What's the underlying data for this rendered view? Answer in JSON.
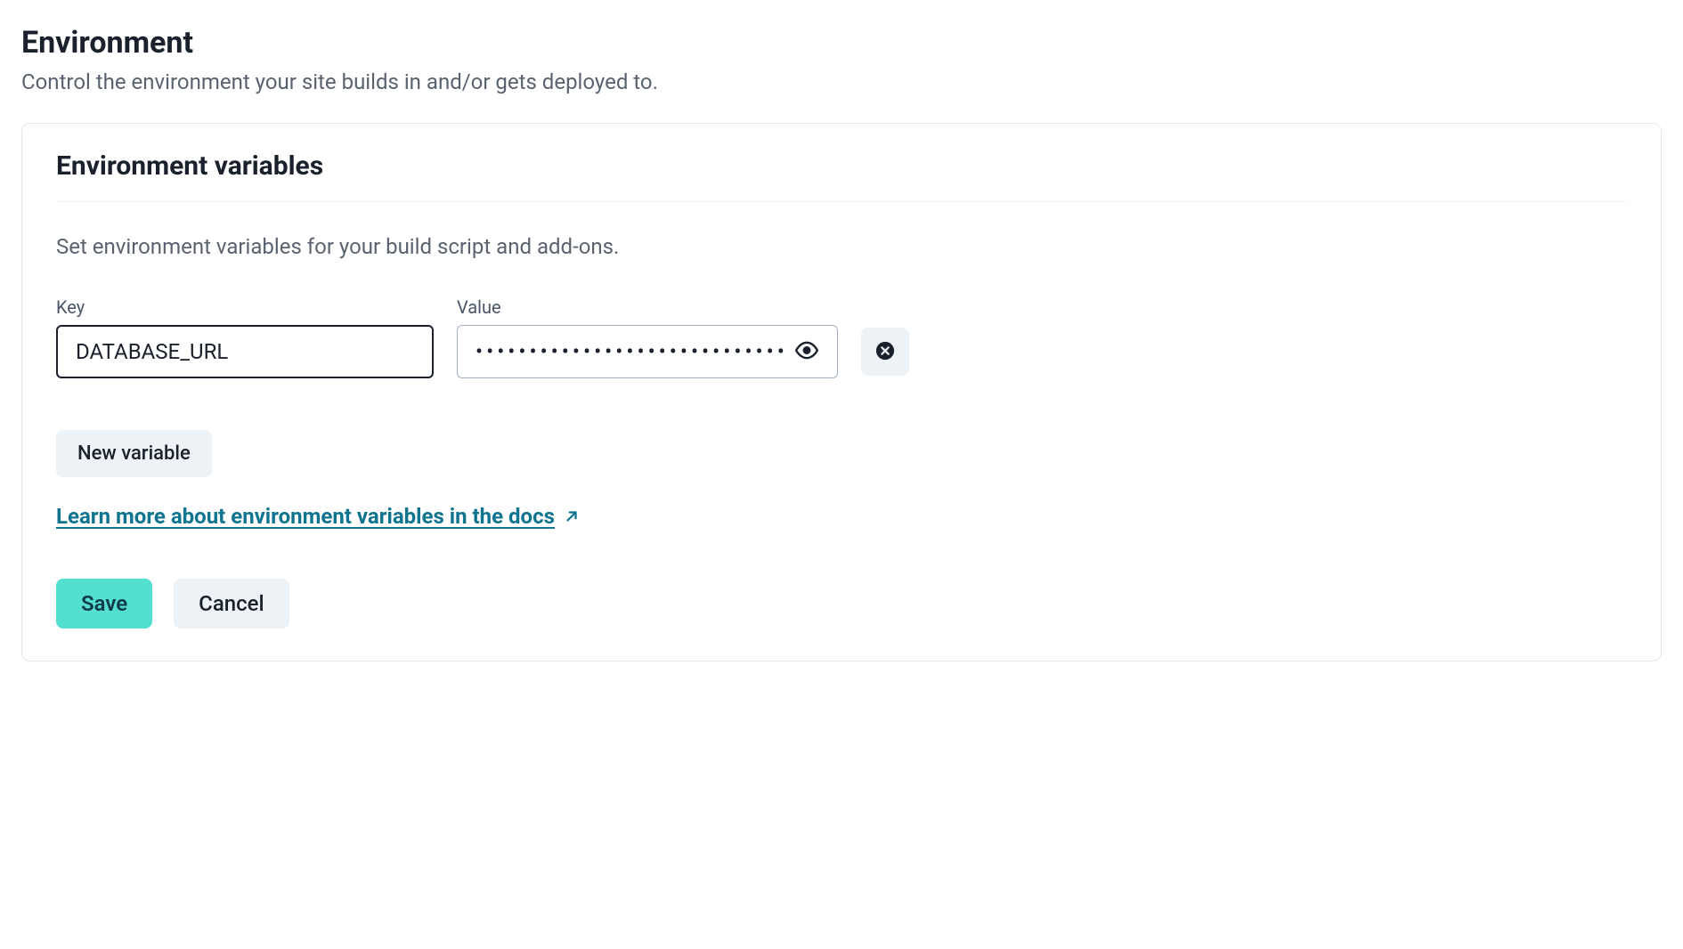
{
  "page": {
    "title": "Environment",
    "subtitle": "Control the environment your site builds in and/or gets deployed to."
  },
  "card": {
    "title": "Environment variables",
    "description": "Set environment variables for your build script and add-ons.",
    "key_label": "Key",
    "value_label": "Value",
    "variables": [
      {
        "key": "DATABASE_URL",
        "value_masked": "••••••••••••••••••••••••••••••••"
      }
    ],
    "new_variable_label": "New variable",
    "docs_link_label": "Learn more about environment variables in the docs",
    "save_label": "Save",
    "cancel_label": "Cancel"
  },
  "icons": {
    "eye": "eye-icon",
    "delete": "x-circle-icon",
    "external": "external-link-icon"
  }
}
